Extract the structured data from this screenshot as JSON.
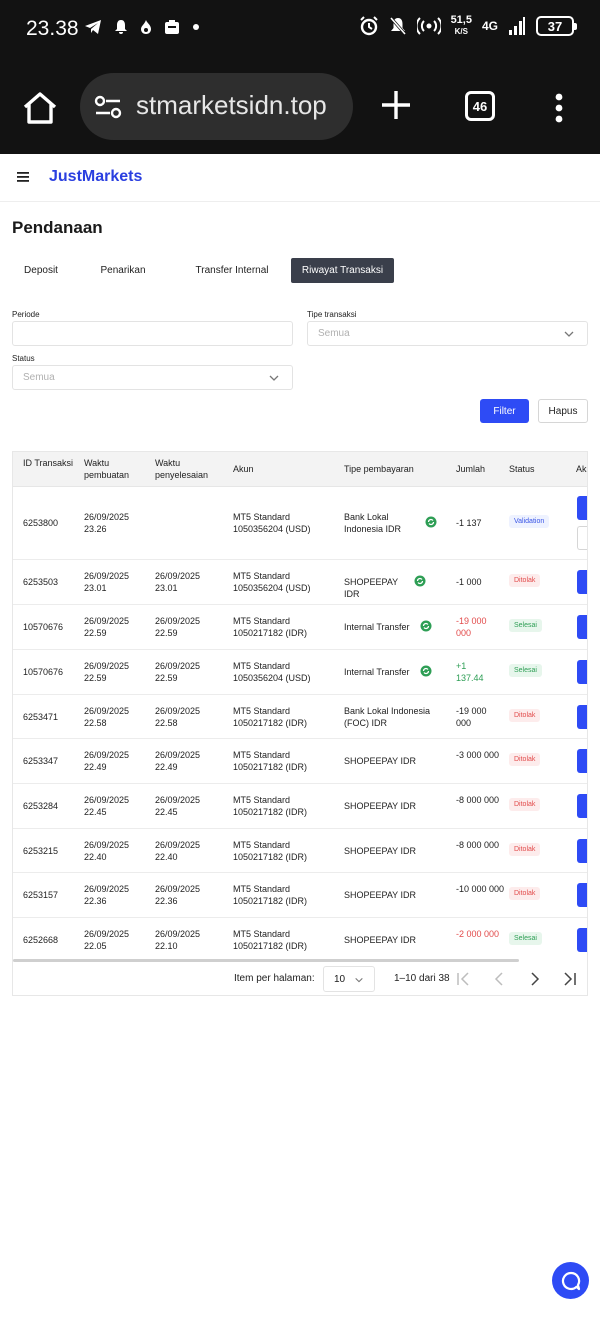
{
  "status_bar": {
    "time": "23.38",
    "net_speed_value": "51,5",
    "net_speed_unit": "K/S",
    "network": "4G",
    "battery": "37"
  },
  "browser": {
    "url": "stmarketsidn.top",
    "tab_count": "46"
  },
  "app": {
    "logo": "JustMarkets"
  },
  "page": {
    "title": "Pendanaan",
    "tabs": [
      {
        "label": "Deposit",
        "active": false
      },
      {
        "label": "Penarikan",
        "active": false
      },
      {
        "label": "Transfer Internal",
        "active": false
      },
      {
        "label": "Riwayat Transaksi",
        "active": true
      }
    ]
  },
  "filters": {
    "periode_label": "Periode",
    "periode_value": "",
    "tipe_label": "Tipe transaksi",
    "tipe_value": "Semua",
    "status_label": "Status",
    "status_value": "Semua",
    "filter_button": "Filter",
    "clear_button": "Hapus"
  },
  "table": {
    "headers": {
      "id": "ID Transaksi",
      "created": "Waktu pembuatan",
      "completed": "Waktu penyelesaian",
      "account": "Akun",
      "payment": "Tipe pembayaran",
      "amount": "Jumlah",
      "status": "Status",
      "action": "Ak"
    },
    "rows": [
      {
        "id": "6253800",
        "created": "26/09/2025 23.26",
        "completed": "",
        "account": "MT5 Standard 1050356204 (USD)",
        "payment": "Bank Lokal Indonesia IDR",
        "amount": "-1 137",
        "status": "Validation"
      },
      {
        "id": "6253503",
        "created": "26/09/2025 23.01",
        "completed": "26/09/2025 23.01",
        "account": "MT5 Standard 1050356204 (USD)",
        "payment": "SHOPEEPAY IDR",
        "amount": "-1 000",
        "status": "Ditolak"
      },
      {
        "id": "10570676",
        "created": "26/09/2025 22.59",
        "completed": "26/09/2025 22.59",
        "account": "MT5 Standard 1050217182 (IDR)",
        "payment": "Internal Transfer",
        "amount": "-19 000 000",
        "status": "Selesai"
      },
      {
        "id": "10570676",
        "created": "26/09/2025 22.59",
        "completed": "26/09/2025 22.59",
        "account": "MT5 Standard 1050356204 (USD)",
        "payment": "Internal Transfer",
        "amount": "+1 137.44",
        "status": "Selesai"
      },
      {
        "id": "6253471",
        "created": "26/09/2025 22.58",
        "completed": "26/09/2025 22.58",
        "account": "MT5 Standard 1050217182 (IDR)",
        "payment": "Bank Lokal Indonesia (FOC) IDR",
        "amount": "-19 000 000",
        "status": "Ditolak"
      },
      {
        "id": "6253347",
        "created": "26/09/2025 22.49",
        "completed": "26/09/2025 22.49",
        "account": "MT5 Standard 1050217182 (IDR)",
        "payment": "SHOPEEPAY IDR",
        "amount": "-3 000 000",
        "status": "Ditolak"
      },
      {
        "id": "6253284",
        "created": "26/09/2025 22.45",
        "completed": "26/09/2025 22.45",
        "account": "MT5 Standard 1050217182 (IDR)",
        "payment": "SHOPEEPAY IDR",
        "amount": "-8 000 000",
        "status": "Ditolak"
      },
      {
        "id": "6253215",
        "created": "26/09/2025 22.40",
        "completed": "26/09/2025 22.40",
        "account": "MT5 Standard 1050217182 (IDR)",
        "payment": "SHOPEEPAY IDR",
        "amount": "-8 000 000",
        "status": "Ditolak"
      },
      {
        "id": "6253157",
        "created": "26/09/2025 22.36",
        "completed": "26/09/2025 22.36",
        "account": "MT5 Standard 1050217182 (IDR)",
        "payment": "SHOPEEPAY IDR",
        "amount": "-10 000 000",
        "status": "Ditolak"
      },
      {
        "id": "6252668",
        "created": "26/09/2025 22.05",
        "completed": "26/09/2025 22.10",
        "account": "MT5 Standard 1050217182 (IDR)",
        "payment": "SHOPEEPAY IDR",
        "amount": "-2 000 000",
        "status": "Selesai"
      }
    ]
  },
  "pagination": {
    "per_page_label": "Item per halaman:",
    "per_page_value": "10",
    "range": "1–10 dari 38"
  },
  "colors": {
    "accent": "#2e4bf5",
    "brand": "#2a3fe0",
    "negative": "#e24b4b",
    "positive": "#2e9e55",
    "payment_icon": "#2e9e55"
  }
}
